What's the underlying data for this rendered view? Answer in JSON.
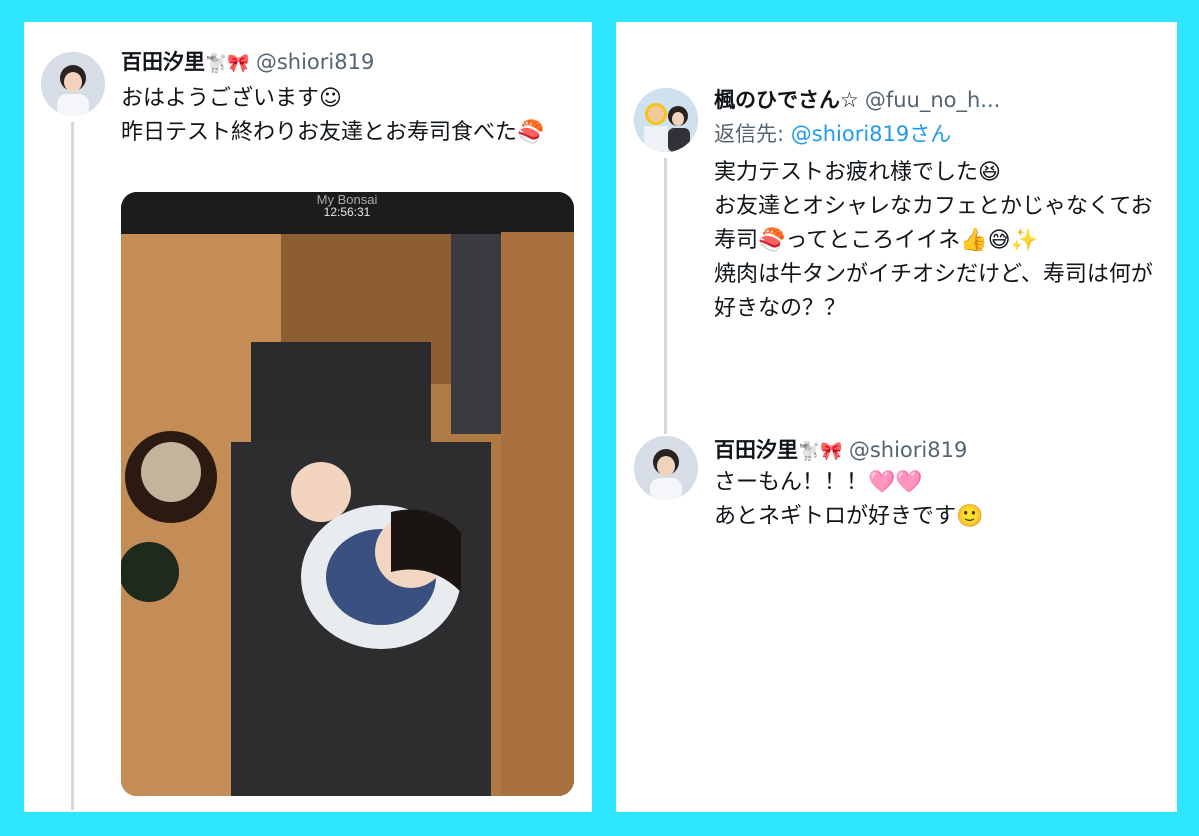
{
  "left_tweet": {
    "name": "百田汐里",
    "name_emoji": "🐩🎀",
    "handle": "@shiori819",
    "text": "おはようございます☺\n昨日テスト終わりお友達とお寿司食べた🍣",
    "photo": {
      "overlay_title": "My Bonsai",
      "overlay_time": "12:56:31"
    }
  },
  "right_tweet": {
    "name": "楓のひでさん☆",
    "handle": "@fuu_no_h...",
    "reply_prefix": "返信先: ",
    "reply_to": "@shiori819さん",
    "text": "実力テストお疲れ様でした😆\nお友達とオシャレなカフェとかじゃなくてお寿司🍣ってところイイネ👍😅✨\n焼肉は牛タンがイチオシだけど、寿司は何が好きなの？？"
  },
  "reply_tweet": {
    "name": "百田汐里",
    "name_emoji": "🐩🎀",
    "handle": "@shiori819",
    "text": "さーもん！！！🩷🩷\nあとネギトロが好きです🙂"
  },
  "colors": {
    "background": "#2ee6ff",
    "card": "#ffffff",
    "mention": "#1d9bf0",
    "handle": "#536471"
  }
}
